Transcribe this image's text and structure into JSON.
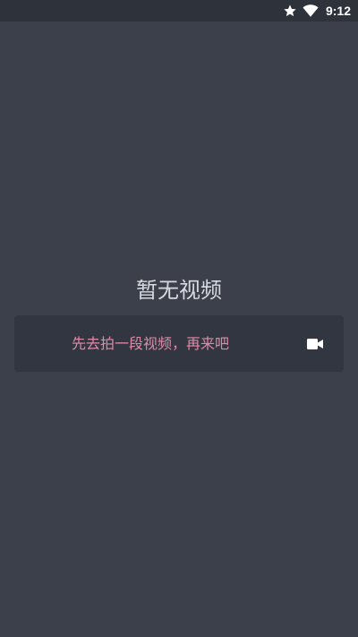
{
  "status_bar": {
    "time": "9:12",
    "icons": [
      "star-icon",
      "wifi-icon"
    ]
  },
  "empty_state": {
    "title": "暂无视频",
    "action_label": "先去拍一段视频，再来吧",
    "action_icon": "video-camera-icon"
  },
  "colors": {
    "background": "#3b404b",
    "status_bar": "#2e323b",
    "card": "#323640",
    "accent_text": "#e08aa9",
    "title_text": "#d7d9de"
  }
}
